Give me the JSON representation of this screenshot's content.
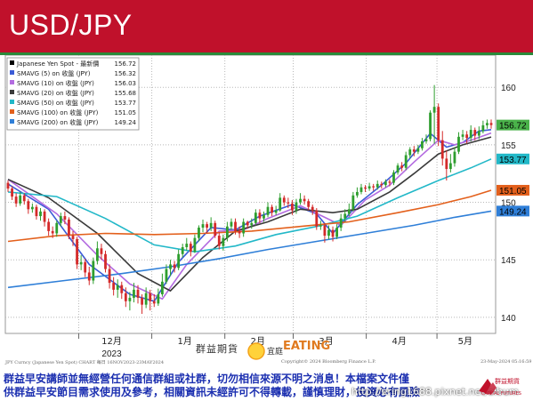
{
  "header": {
    "title": "USD/JPY"
  },
  "chart_data": {
    "type": "candlestick",
    "price_axis": {
      "ticks": [
        140,
        145,
        150,
        155,
        160
      ],
      "range": [
        138.6,
        162.8
      ],
      "side": "right"
    },
    "time_axis": {
      "labels": [
        "12月",
        "1月",
        "2月",
        "3月",
        "4月",
        "5月"
      ],
      "year_label": "2023",
      "range": [
        "2023-11-01",
        "2024-05-24"
      ]
    },
    "grid": true,
    "legend_placement": "top-left",
    "legend": [
      {
        "label": "Japanese Yen Spot - 最新價",
        "value": "156.72",
        "color": "#000000"
      },
      {
        "label": "SMAVG (5)  on 收盤 (JPY)",
        "value": "156.32",
        "color": "#3b5bd6"
      },
      {
        "label": "SMAVG (10)  on 收盤 (JPY)",
        "value": "156.03",
        "color": "#b36be0"
      },
      {
        "label": "SMAVG (20)  on 收盤 (JPY)",
        "value": "155.68",
        "color": "#3a3a3a"
      },
      {
        "label": "SMAVG (50)  on 收盤 (JPY)",
        "value": "153.77",
        "color": "#22b8c8"
      },
      {
        "label": "SMAVG (100)  on 收盤 (JPY)",
        "value": "151.05",
        "color": "#e3601c"
      },
      {
        "label": "SMAVG (200)  on 收盤 (JPY)",
        "value": "149.24",
        "color": "#2f7fd8"
      }
    ],
    "last_value_tags": [
      {
        "value": "156.72",
        "color": "#4ab24a"
      },
      {
        "value": "153.77",
        "color": "#22b8c8"
      },
      {
        "value": "151.05",
        "color": "#e3601c"
      },
      {
        "value": "149.24",
        "color": "#2f7fd8"
      }
    ],
    "candles": [
      [
        151.7,
        151.2,
        151.9,
        150.9
      ],
      [
        151.2,
        150.5,
        151.4,
        150.2
      ],
      [
        150.5,
        149.9,
        150.8,
        149.6
      ],
      [
        149.9,
        150.6,
        150.9,
        149.7
      ],
      [
        150.6,
        150.1,
        150.8,
        149.8
      ],
      [
        150.1,
        149.4,
        150.3,
        149.0
      ],
      [
        149.4,
        149.6,
        149.9,
        149.1
      ],
      [
        149.6,
        148.8,
        149.8,
        148.5
      ],
      [
        148.8,
        149.2,
        149.5,
        148.4
      ],
      [
        149.2,
        148.3,
        149.4,
        147.9
      ],
      [
        148.3,
        147.5,
        148.6,
        147.1
      ],
      [
        147.5,
        147.3,
        147.9,
        146.9
      ],
      [
        147.3,
        148.2,
        148.4,
        147.0
      ],
      [
        148.2,
        148.8,
        149.1,
        147.9
      ],
      [
        148.8,
        148.5,
        149.2,
        148.1
      ],
      [
        148.5,
        147.1,
        148.7,
        146.8
      ],
      [
        147.1,
        146.8,
        147.5,
        146.2
      ],
      [
        146.8,
        144.6,
        147.0,
        144.2
      ],
      [
        144.6,
        144.8,
        145.4,
        144.1
      ],
      [
        144.8,
        143.9,
        145.1,
        143.5
      ],
      [
        143.9,
        143.2,
        144.4,
        142.8
      ],
      [
        143.2,
        144.9,
        145.2,
        142.9
      ],
      [
        144.9,
        146.0,
        146.6,
        144.6
      ],
      [
        146.0,
        145.5,
        146.4,
        145.0
      ],
      [
        145.5,
        144.2,
        145.8,
        143.9
      ],
      [
        144.2,
        143.0,
        144.6,
        142.5
      ],
      [
        143.0,
        142.4,
        143.5,
        141.9
      ],
      [
        142.4,
        142.8,
        143.3,
        141.7
      ],
      [
        142.8,
        142.1,
        143.1,
        141.6
      ],
      [
        142.1,
        141.4,
        142.6,
        140.9
      ],
      [
        141.4,
        141.7,
        142.2,
        140.6
      ],
      [
        141.7,
        142.4,
        143.0,
        141.3
      ],
      [
        142.4,
        141.7,
        142.8,
        141.2
      ],
      [
        141.7,
        141.1,
        142.0,
        140.3
      ],
      [
        141.1,
        142.1,
        142.6,
        140.8
      ],
      [
        142.1,
        141.4,
        142.4,
        140.6
      ],
      [
        141.4,
        141.2,
        142.0,
        140.9
      ],
      [
        141.2,
        142.0,
        142.5,
        141.0
      ],
      [
        142.0,
        143.1,
        143.8,
        141.8
      ],
      [
        143.1,
        144.2,
        144.6,
        142.9
      ],
      [
        144.2,
        144.6,
        145.0,
        143.6
      ],
      [
        144.6,
        144.3,
        144.9,
        143.9
      ],
      [
        144.3,
        145.5,
        145.9,
        144.1
      ],
      [
        145.5,
        146.1,
        146.4,
        145.2
      ],
      [
        146.1,
        146.4,
        146.9,
        145.8
      ],
      [
        146.4,
        145.7,
        146.6,
        145.3
      ],
      [
        145.7,
        146.9,
        147.2,
        145.6
      ],
      [
        146.9,
        147.8,
        148.0,
        146.6
      ],
      [
        147.8,
        148.1,
        148.5,
        147.4
      ],
      [
        148.1,
        147.8,
        148.3,
        147.3
      ],
      [
        147.8,
        148.2,
        148.7,
        147.5
      ],
      [
        148.2,
        147.1,
        148.4,
        146.9
      ],
      [
        147.1,
        146.2,
        147.4,
        145.9
      ],
      [
        146.2,
        146.9,
        147.2,
        145.8
      ],
      [
        146.9,
        147.9,
        148.3,
        146.6
      ],
      [
        147.9,
        148.3,
        148.6,
        147.6
      ],
      [
        148.3,
        147.5,
        148.6,
        147.2
      ],
      [
        147.5,
        147.3,
        147.9,
        146.9
      ],
      [
        147.3,
        148.3,
        148.6,
        147.0
      ],
      [
        148.3,
        148.0,
        148.4,
        147.7
      ],
      [
        148.0,
        148.2,
        148.6,
        147.7
      ],
      [
        148.2,
        149.1,
        149.4,
        148.0
      ],
      [
        149.1,
        148.6,
        149.4,
        148.2
      ],
      [
        148.6,
        148.9,
        149.2,
        148.3
      ],
      [
        148.9,
        149.6,
        150.0,
        148.7
      ],
      [
        149.6,
        149.1,
        149.8,
        148.8
      ],
      [
        149.1,
        149.3,
        149.7,
        148.9
      ],
      [
        149.3,
        150.4,
        150.8,
        149.2
      ],
      [
        150.4,
        150.0,
        150.6,
        149.7
      ],
      [
        150.0,
        149.9,
        150.4,
        149.5
      ],
      [
        149.9,
        149.3,
        150.2,
        148.9
      ],
      [
        149.3,
        150.0,
        150.3,
        149.0
      ],
      [
        150.0,
        150.3,
        150.8,
        149.8
      ],
      [
        150.3,
        150.1,
        150.6,
        149.8
      ],
      [
        150.1,
        149.6,
        150.3,
        149.3
      ],
      [
        149.6,
        149.3,
        149.8,
        148.9
      ],
      [
        149.3,
        147.9,
        149.5,
        147.6
      ],
      [
        147.9,
        148.0,
        148.4,
        147.6
      ],
      [
        148.0,
        147.1,
        148.2,
        146.5
      ],
      [
        147.1,
        147.6,
        148.0,
        146.8
      ],
      [
        147.6,
        147.0,
        147.9,
        146.6
      ],
      [
        147.0,
        147.8,
        148.1,
        146.8
      ],
      [
        147.8,
        148.6,
        149.0,
        147.5
      ],
      [
        148.6,
        149.0,
        149.4,
        148.3
      ],
      [
        149.0,
        149.4,
        149.9,
        148.8
      ],
      [
        149.4,
        150.6,
        150.9,
        149.2
      ],
      [
        150.6,
        150.9,
        151.3,
        150.4
      ],
      [
        150.9,
        151.3,
        151.6,
        150.7
      ],
      [
        151.3,
        151.2,
        151.5,
        150.9
      ],
      [
        151.2,
        151.4,
        151.7,
        151.0
      ],
      [
        151.4,
        151.3,
        151.6,
        151.0
      ],
      [
        151.3,
        151.6,
        151.9,
        151.1
      ],
      [
        151.6,
        151.5,
        151.8,
        151.2
      ],
      [
        151.5,
        151.8,
        152.0,
        151.3
      ],
      [
        151.8,
        151.7,
        152.0,
        151.4
      ],
      [
        151.7,
        152.6,
        152.8,
        151.5
      ],
      [
        152.6,
        153.2,
        153.4,
        152.4
      ],
      [
        153.2,
        153.0,
        153.5,
        152.7
      ],
      [
        153.0,
        154.1,
        154.4,
        152.8
      ],
      [
        154.1,
        154.6,
        154.8,
        153.8
      ],
      [
        154.6,
        154.4,
        154.9,
        154.0
      ],
      [
        154.4,
        154.7,
        155.0,
        154.2
      ],
      [
        154.7,
        155.3,
        155.6,
        154.5
      ],
      [
        155.3,
        155.5,
        155.9,
        155.1
      ],
      [
        155.5,
        157.8,
        158.0,
        155.3
      ],
      [
        157.8,
        158.3,
        160.2,
        155.1
      ],
      [
        158.3,
        155.4,
        158.6,
        154.9
      ],
      [
        155.4,
        153.8,
        156.2,
        153.2
      ],
      [
        153.8,
        152.9,
        154.5,
        151.9
      ],
      [
        152.9,
        153.4,
        154.2,
        152.6
      ],
      [
        153.4,
        154.4,
        154.8,
        153.1
      ],
      [
        154.4,
        155.7,
        156.1,
        154.2
      ],
      [
        155.7,
        155.9,
        156.3,
        155.4
      ],
      [
        155.9,
        155.6,
        156.2,
        155.1
      ],
      [
        155.6,
        156.3,
        156.7,
        155.3
      ],
      [
        156.3,
        155.8,
        156.5,
        155.4
      ],
      [
        155.8,
        156.2,
        156.6,
        155.5
      ],
      [
        156.2,
        156.7,
        157.1,
        156.0
      ],
      [
        156.7,
        156.9,
        157.2,
        156.4
      ],
      [
        156.9,
        156.72,
        157.2,
        156.4
      ]
    ],
    "moving_averages": [
      {
        "name": "SMAVG (5)",
        "color": "#3b5bd6",
        "points": [
          [
            0,
            151.6
          ],
          [
            10,
            149.4
          ],
          [
            20,
            144.6
          ],
          [
            30,
            142.0
          ],
          [
            36,
            141.4
          ],
          [
            42,
            144.8
          ],
          [
            50,
            147.8
          ],
          [
            56,
            147.6
          ],
          [
            62,
            148.8
          ],
          [
            70,
            149.8
          ],
          [
            76,
            149.0
          ],
          [
            80,
            147.3
          ],
          [
            86,
            149.8
          ],
          [
            92,
            151.5
          ],
          [
            98,
            153.4
          ],
          [
            104,
            156.0
          ],
          [
            108,
            154.8
          ],
          [
            112,
            155.2
          ],
          [
            116,
            156.2
          ],
          [
            119,
            156.32
          ]
        ]
      },
      {
        "name": "SMAVG (10)",
        "color": "#b36be0",
        "points": [
          [
            0,
            152.0
          ],
          [
            12,
            149.0
          ],
          [
            22,
            145.4
          ],
          [
            30,
            142.9
          ],
          [
            38,
            141.6
          ],
          [
            44,
            144.6
          ],
          [
            52,
            147.5
          ],
          [
            58,
            147.6
          ],
          [
            64,
            148.6
          ],
          [
            72,
            149.7
          ],
          [
            78,
            148.7
          ],
          [
            82,
            148.0
          ],
          [
            88,
            150.2
          ],
          [
            94,
            151.5
          ],
          [
            100,
            153.5
          ],
          [
            106,
            155.4
          ],
          [
            110,
            155.0
          ],
          [
            114,
            155.4
          ],
          [
            119,
            156.03
          ]
        ]
      },
      {
        "name": "SMAVG (20)",
        "color": "#3a3a3a",
        "points": [
          [
            0,
            152.0
          ],
          [
            10,
            150.4
          ],
          [
            22,
            147.3
          ],
          [
            32,
            143.8
          ],
          [
            40,
            142.3
          ],
          [
            48,
            145.2
          ],
          [
            56,
            147.5
          ],
          [
            64,
            148.3
          ],
          [
            72,
            149.4
          ],
          [
            80,
            149.1
          ],
          [
            86,
            149.4
          ],
          [
            94,
            150.9
          ],
          [
            100,
            152.5
          ],
          [
            106,
            154.2
          ],
          [
            112,
            155.0
          ],
          [
            119,
            155.68
          ]
        ]
      },
      {
        "name": "SMAVG (50)",
        "color": "#22b8c8",
        "points": [
          [
            0,
            150.9
          ],
          [
            12,
            150.5
          ],
          [
            24,
            148.6
          ],
          [
            36,
            146.3
          ],
          [
            46,
            145.7
          ],
          [
            56,
            146.2
          ],
          [
            66,
            147.2
          ],
          [
            76,
            147.9
          ],
          [
            86,
            148.8
          ],
          [
            96,
            150.4
          ],
          [
            106,
            151.9
          ],
          [
            114,
            153.0
          ],
          [
            119,
            153.77
          ]
        ]
      },
      {
        "name": "SMAVG (100)",
        "color": "#e3601c",
        "points": [
          [
            0,
            146.6
          ],
          [
            12,
            147.1
          ],
          [
            24,
            147.3
          ],
          [
            36,
            147.2
          ],
          [
            48,
            147.3
          ],
          [
            60,
            147.5
          ],
          [
            72,
            147.9
          ],
          [
            84,
            148.3
          ],
          [
            96,
            149.1
          ],
          [
            106,
            149.8
          ],
          [
            114,
            150.5
          ],
          [
            119,
            151.05
          ]
        ]
      },
      {
        "name": "SMAVG (200)",
        "color": "#2f7fd8",
        "points": [
          [
            0,
            142.6
          ],
          [
            14,
            143.2
          ],
          [
            28,
            143.8
          ],
          [
            40,
            144.4
          ],
          [
            52,
            145.1
          ],
          [
            64,
            145.9
          ],
          [
            76,
            146.6
          ],
          [
            88,
            147.3
          ],
          [
            100,
            148.0
          ],
          [
            110,
            148.7
          ],
          [
            119,
            149.24
          ]
        ]
      }
    ]
  },
  "footer": {
    "left": "JPY Curncy (Japanese Yen Spot) CHART 每日 16NOV2023-23MAY2024",
    "mid": "Copyright© 2024 Bloomberg Finance L.P.",
    "right": "23-May-2024 05:16:59"
  },
  "stamp": {
    "left": "群益期貨",
    "mid": "宜庭",
    "right": "EATING"
  },
  "disclaimer": {
    "line1": "群益早安講師並無經營任何通信群組或社群，切勿相信來源不明之消息！本檔案文件僅",
    "line2": "供群益早安節目需求使用及參考，相關資訊未經許可不得轉載，謹慎理財，投資必有風險"
  },
  "watermark": "http://ering1688.pixnet.net/album",
  "logo": {
    "name": "群益期貨",
    "sub": "CAPITAL FUTURES"
  }
}
